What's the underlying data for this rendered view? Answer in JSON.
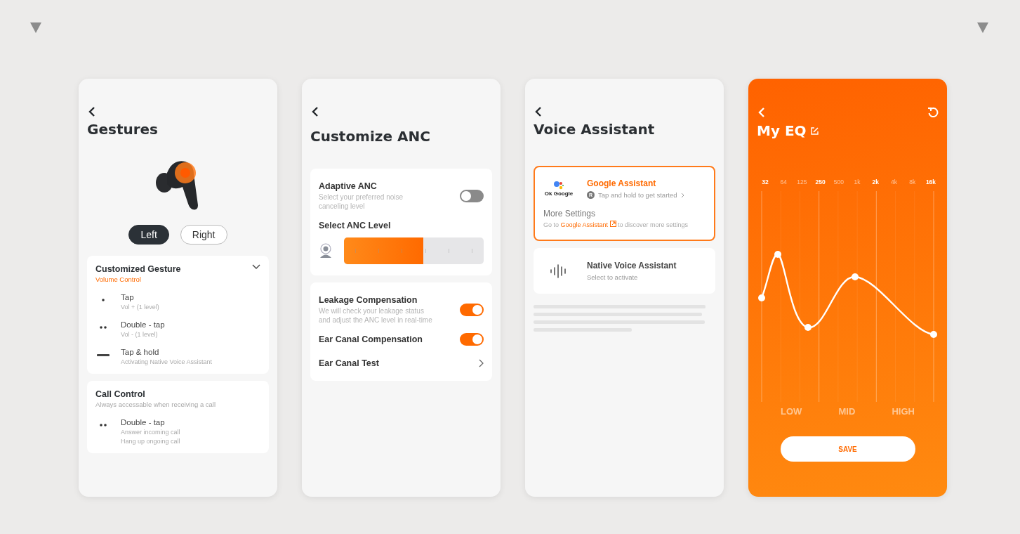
{
  "gestures": {
    "title": "Gestures",
    "sides": [
      {
        "label": "Left",
        "selected": true
      },
      {
        "label": "Right",
        "selected": false
      }
    ],
    "sections": [
      {
        "title": "Customized Gesture",
        "subtitle": "Volume Control",
        "accent": true,
        "collapsible": true,
        "items": [
          {
            "kind": "tap",
            "name": "Tap",
            "actions": [
              "Vol + (1 level)"
            ]
          },
          {
            "kind": "double_tap",
            "name": "Double - tap",
            "actions": [
              "Vol - (1 level)"
            ]
          },
          {
            "kind": "hold",
            "name": "Tap & hold",
            "actions": [
              "Activating Native Voice Assistant"
            ]
          }
        ]
      },
      {
        "title": "Call Control",
        "subtitle": "Always accessable when receiving a call",
        "accent": false,
        "collapsible": false,
        "items": [
          {
            "kind": "double_tap",
            "name": "Double - tap",
            "actions": [
              "Answer incoming call",
              "Hang up ongoing call"
            ]
          }
        ]
      }
    ]
  },
  "anc": {
    "title": "Customize ANC",
    "panels": [
      [
        {
          "kind": "toggle",
          "title": "Adaptive ANC",
          "description": "Select your preferred noise canceling level",
          "on": false
        },
        {
          "kind": "level",
          "title": "Select ANC Level",
          "level": 0.57
        }
      ],
      [
        {
          "kind": "toggle",
          "title": "Leakage Compensation",
          "description": "We will check your leakage status and adjust the ANC level in real-time",
          "on": true
        },
        {
          "kind": "toggle",
          "title": "Ear Canal Compensation",
          "on": true
        },
        {
          "kind": "link",
          "title": "Ear Canal Test"
        }
      ]
    ]
  },
  "voice": {
    "title": "Voice Assistant",
    "options": [
      {
        "kind": "google",
        "logo_text": "Ok Google",
        "title": "Google Assistant",
        "badge": "R",
        "hint": "Tap and hold to get started",
        "selected": true,
        "more_title": "More Settings",
        "more_before": "Go to ",
        "more_link": "Google Assistant",
        "more_after": " to discover more settings"
      },
      {
        "kind": "native",
        "title": "Native Voice Assistant",
        "hint": "Select to activate",
        "selected": false
      }
    ]
  },
  "eq": {
    "title": "My EQ",
    "bands": [
      {
        "label": "32",
        "bold": true
      },
      {
        "label": "64",
        "bold": false
      },
      {
        "label": "125",
        "bold": false
      },
      {
        "label": "250",
        "bold": true
      },
      {
        "label": "500",
        "bold": false
      },
      {
        "label": "1k",
        "bold": false
      },
      {
        "label": "2k",
        "bold": true
      },
      {
        "label": "4k",
        "bold": false
      },
      {
        "label": "8k",
        "bold": false
      },
      {
        "label": "16k",
        "bold": true
      }
    ],
    "ranges": [
      "LOW",
      "MID",
      "HIGH"
    ],
    "save": "SAVE"
  }
}
